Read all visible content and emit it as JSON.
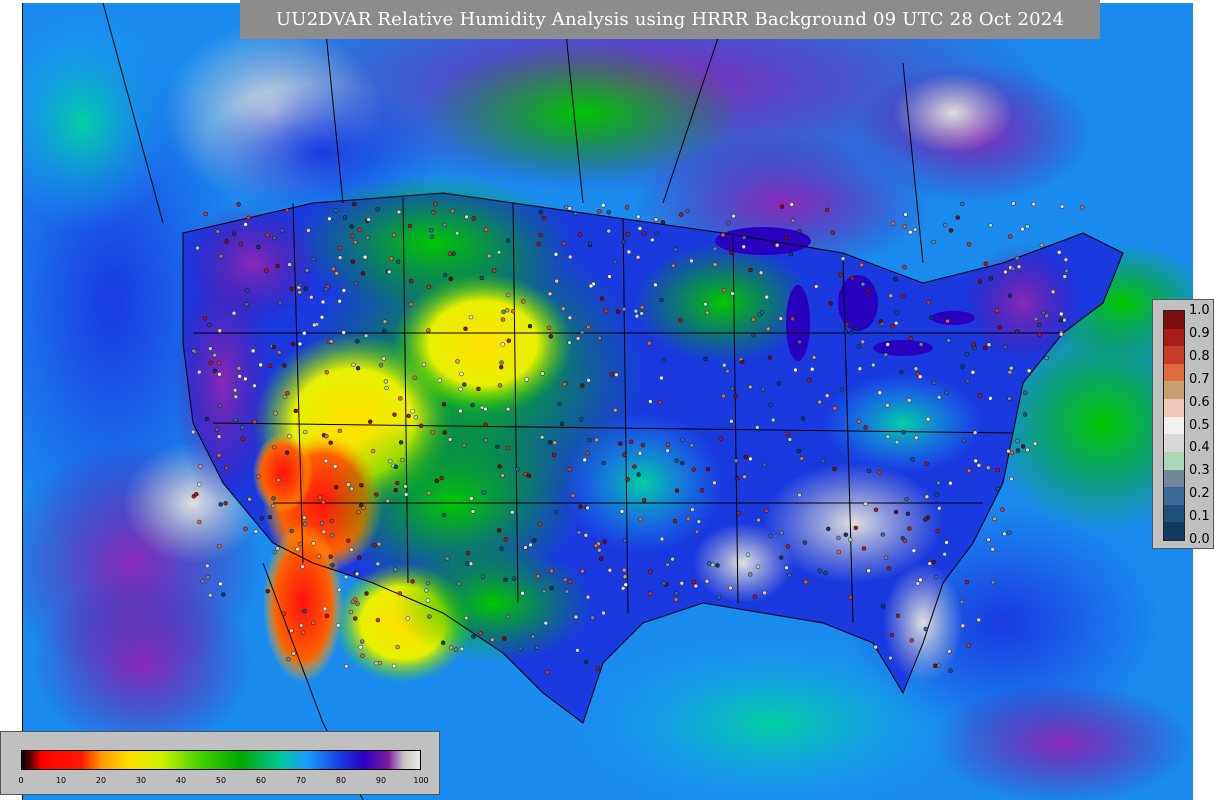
{
  "title": "UU2DVAR Relative Humidity Analysis using HRRR Background 09 UTC 28 Oct 2024",
  "map": {
    "field": "relative-humidity-analysis",
    "region": "CONUS",
    "basemap_colors": {
      "ocean_deep": "#1f6fe0",
      "ocean_moist": "#1aa0ff",
      "very_moist": "#6a2ab0",
      "saturated": "#d8d8d8",
      "moderate": "#00c400",
      "dry_yellow": "#ffe000",
      "dry_red": "#ff1010",
      "boundaries": "#000000"
    }
  },
  "right_colorbar": {
    "purpose": "observation-station-error",
    "ticks": [
      "1.0",
      "0.9",
      "0.8",
      "0.7",
      "0.6",
      "0.5",
      "0.4",
      "0.3",
      "0.2",
      "0.1",
      "0.0"
    ],
    "colors": [
      "#7b0e0e",
      "#a81b1b",
      "#c83a2a",
      "#e06a3a",
      "#c8a070",
      "#f0c8b8",
      "#f0f0f0",
      "#d8d8d8",
      "#a8d8b8",
      "#708898",
      "#3a6a9a",
      "#1f4f7a",
      "#123a60"
    ]
  },
  "bottom_colorbar": {
    "purpose": "relative-humidity-percent",
    "ticks": [
      "0",
      "10",
      "20",
      "30",
      "40",
      "50",
      "60",
      "70",
      "80",
      "90",
      "100"
    ],
    "gradient_stops": [
      {
        "pct": 0,
        "color": "#000000"
      },
      {
        "pct": 2,
        "color": "#5a0000"
      },
      {
        "pct": 5,
        "color": "#ff0000"
      },
      {
        "pct": 15,
        "color": "#ff1a00"
      },
      {
        "pct": 20,
        "color": "#ff9a00"
      },
      {
        "pct": 27,
        "color": "#ffe000"
      },
      {
        "pct": 35,
        "color": "#d0f000"
      },
      {
        "pct": 45,
        "color": "#40d000"
      },
      {
        "pct": 55,
        "color": "#00a800"
      },
      {
        "pct": 65,
        "color": "#00c8a0"
      },
      {
        "pct": 72,
        "color": "#1a9aff"
      },
      {
        "pct": 80,
        "color": "#1a3ae0"
      },
      {
        "pct": 86,
        "color": "#2a00c0"
      },
      {
        "pct": 92,
        "color": "#7a1aa0"
      },
      {
        "pct": 96,
        "color": "#c8c8c8"
      },
      {
        "pct": 100,
        "color": "#e8e8e8"
      }
    ]
  }
}
